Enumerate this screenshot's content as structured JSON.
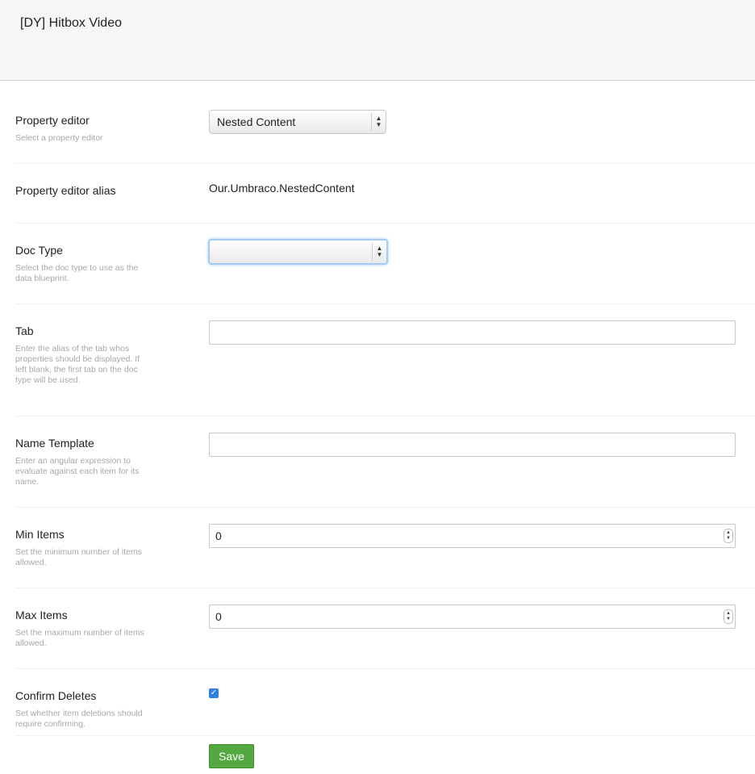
{
  "header": {
    "title": "[DY] Hitbox Video"
  },
  "fields": {
    "property_editor": {
      "label": "Property editor",
      "description": "Select a property editor",
      "selected": "Nested Content"
    },
    "property_editor_alias": {
      "label": "Property editor alias",
      "value": "Our.Umbraco.NestedContent"
    },
    "doc_type": {
      "label": "Doc Type",
      "description": "Select the doc type to use as the data blueprint.",
      "selected": ""
    },
    "tab": {
      "label": "Tab",
      "description": "Enter the alias of the tab whos properties should be displayed. If left blank, the first tab on the doc type will be used.",
      "value": ""
    },
    "name_template": {
      "label": "Name Template",
      "description": "Enter an angular expression to evaluate against each item for its name.",
      "value": ""
    },
    "min_items": {
      "label": "Min Items",
      "description": "Set the minimum number of items allowed.",
      "value": "0"
    },
    "max_items": {
      "label": "Max Items",
      "description": "Set the maximum number of items allowed.",
      "value": "0"
    },
    "confirm_deletes": {
      "label": "Confirm Deletes",
      "description": "Set whether item deletions should require confirming.",
      "checked": true
    }
  },
  "actions": {
    "save_label": "Save"
  },
  "colors": {
    "save_button": "#53a93f",
    "checkbox": "#2f7fe4"
  }
}
